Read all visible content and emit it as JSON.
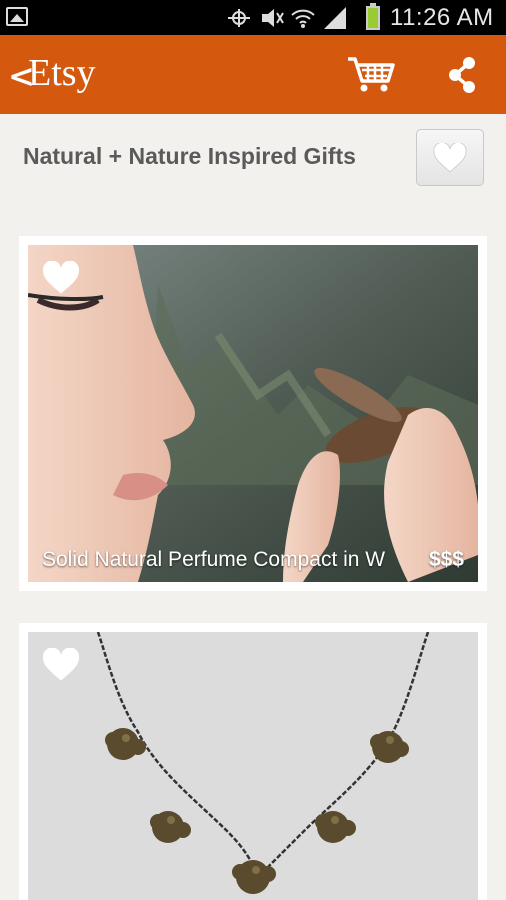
{
  "status_bar": {
    "time": "11:26 AM"
  },
  "app_bar": {
    "back_glyph": "<",
    "brand": "Etsy",
    "cart_icon": "cart-icon",
    "share_icon": "share-icon",
    "bar_color": "#d5580f"
  },
  "page": {
    "title": "Natural + Nature Inspired Gifts",
    "favorite_icon": "heart-icon"
  },
  "listings": [
    {
      "title": "Solid Natural Perfume Compact in W",
      "price": "$$$"
    },
    {
      "title": "",
      "price": ""
    }
  ]
}
